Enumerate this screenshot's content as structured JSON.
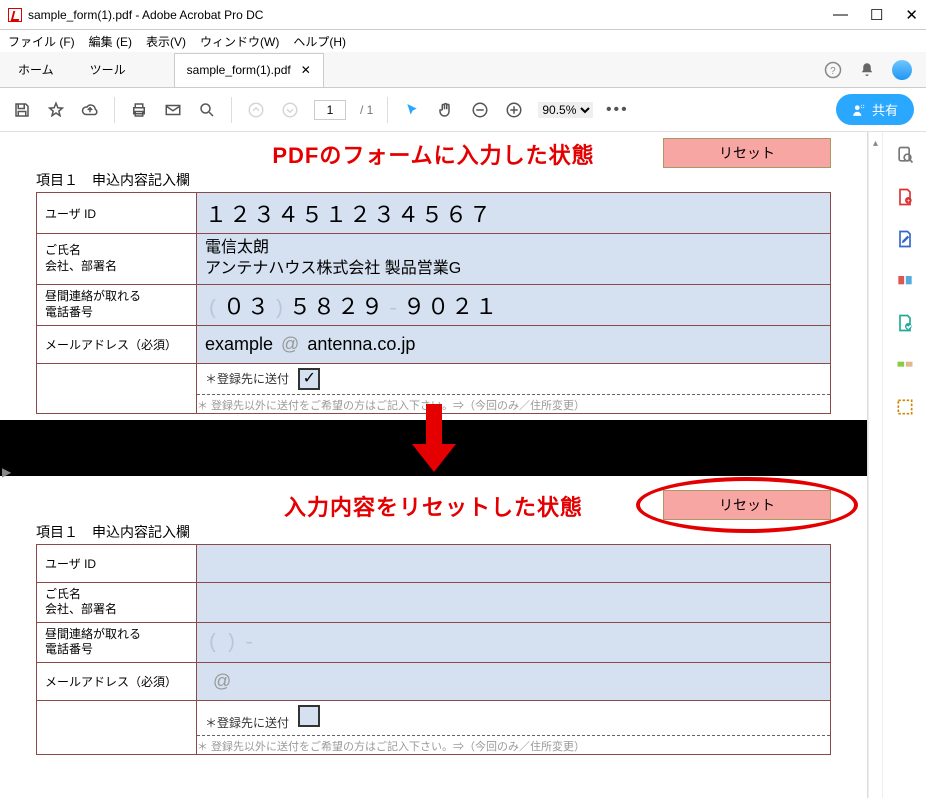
{
  "titlebar": {
    "title": "sample_form(1).pdf - Adobe Acrobat Pro DC"
  },
  "menubar": [
    "ファイル (F)",
    "編集 (E)",
    "表示(V)",
    "ウィンドウ(W)",
    "ヘルプ(H)"
  ],
  "tabs": {
    "home": "ホーム",
    "tools": "ツール",
    "doc": "sample_form(1).pdf"
  },
  "toolbar": {
    "page_current": "1",
    "page_total": "/ 1",
    "zoom": "90.5%",
    "share": "共有"
  },
  "doc": {
    "caption_before": "PDFのフォームに入力した状態",
    "caption_after": "入力内容をリセットした状態",
    "section_label": "項目１　申込内容記入欄",
    "reset_label": "リセット",
    "rows": {
      "user_id_label": "ユーザ ID",
      "name_label_l1": "ご氏名",
      "name_label_l2": "会社、部署名",
      "phone_label_l1": "昼間連絡が取れる",
      "phone_label_l2": "電話番号",
      "email_label": "メールアドレス（必須）",
      "send_label": "＊登録先に送付",
      "note": "＊ 登録先以外に送付をご希望の方はご記入下さい。⇒（今回のみ／住所変更）"
    },
    "filled": {
      "user_id": "１２３４５１２３４５６７",
      "name": "電信太朗",
      "company": "アンテナハウス株式会社  製品営業G",
      "phone_area": "０３",
      "phone_pre": "５８２９",
      "phone_post": "９０２１",
      "email_local": "example",
      "email_domain": "antenna.co.jp",
      "checked": "✓"
    },
    "empty": {
      "user_id": "",
      "name": "",
      "company": "",
      "phone_area": "",
      "phone_pre": "",
      "phone_post": "",
      "email_local": "",
      "email_domain": "",
      "checked": ""
    }
  }
}
